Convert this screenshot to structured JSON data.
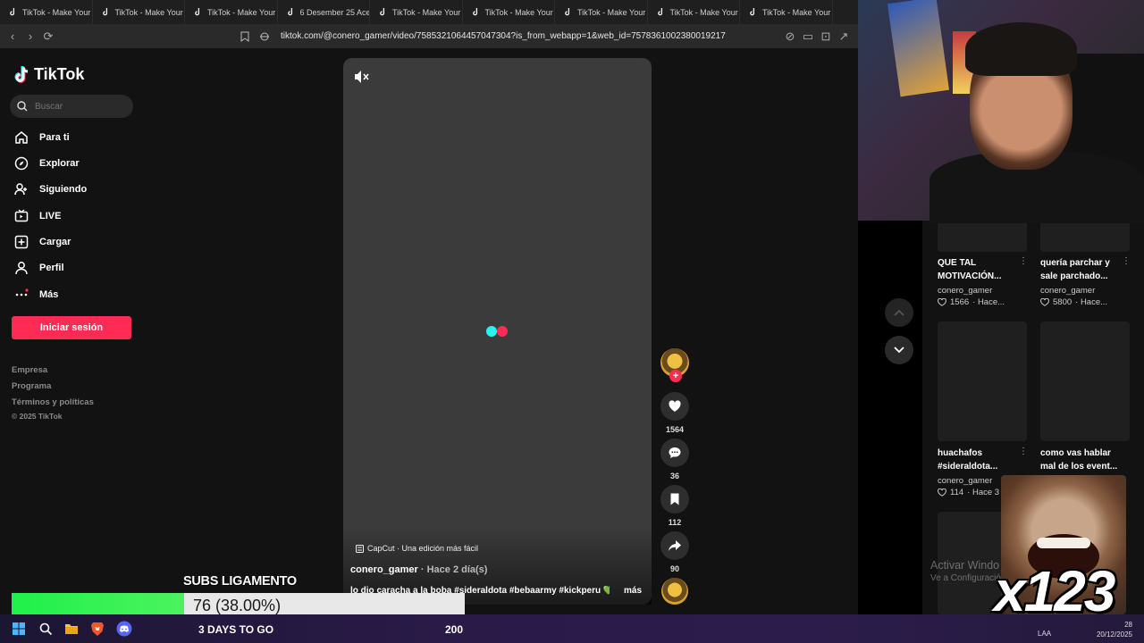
{
  "browser": {
    "tabs": [
      {
        "label": "TikTok - Make Your"
      },
      {
        "label": "TikTok - Make Your"
      },
      {
        "label": "TikTok - Make Your"
      },
      {
        "label": "6 Desember 25 Acer"
      },
      {
        "label": "TikTok - Make Your"
      },
      {
        "label": "TikTok - Make Your"
      },
      {
        "label": "TikTok - Make Your"
      },
      {
        "label": "TikTok - Make Your"
      },
      {
        "label": "TikTok - Make Your"
      }
    ],
    "url": "tiktok.com/@conero_gamer/video/7585321064457047304?is_from_webapp=1&web_id=7578361002380019217"
  },
  "tiktok": {
    "logo_text": "TikTok",
    "search_placeholder": "Buscar",
    "nav": [
      {
        "label": "Para ti",
        "icon": "home-icon"
      },
      {
        "label": "Explorar",
        "icon": "compass-icon"
      },
      {
        "label": "Siguiendo",
        "icon": "following-icon"
      },
      {
        "label": "LIVE",
        "icon": "live-icon"
      },
      {
        "label": "Cargar",
        "icon": "upload-icon"
      },
      {
        "label": "Perfil",
        "icon": "profile-icon"
      },
      {
        "label": "Más",
        "icon": "more-icon"
      }
    ],
    "login_label": "Iniciar sesión",
    "footer": [
      "Empresa",
      "Programa",
      "Términos y políticas",
      "© 2025 TikTok"
    ],
    "video": {
      "capcut": "CapCut · Una edición más fácil",
      "author": "conero_gamer",
      "ago": " · Hace 2 día(s)",
      "description": "lo dio caracha a la boba #sideraldota #bebaarmy #kickperu 💚 ...",
      "more": "más"
    },
    "actions": {
      "likes": "1564",
      "comments": "36",
      "saves": "112",
      "shares": "90"
    },
    "related": [
      {
        "title_1": "QUE TAL",
        "title_2": "MOTIVACIÓN...",
        "channel": "conero_gamer",
        "likes": "1566",
        "ago": "· Hace..."
      },
      {
        "title_1": "quería parchar y",
        "title_2": "sale parchado...",
        "channel": "conero_gamer",
        "likes": "5800",
        "ago": "· Hace..."
      },
      {
        "title_1": "huachafos",
        "title_2": "#sideraldota...",
        "channel": "conero_gamer",
        "likes": "114",
        "ago": "· Hace 3 c"
      },
      {
        "title_1": "como vas hablar",
        "title_2": "mal de los event...",
        "channel": "",
        "likes": "",
        "ago": ""
      }
    ]
  },
  "overlay": {
    "subs_title": "SUBS LIGAMENTO",
    "subs_progress": 0.38,
    "subs_text": "76 (38.00%)",
    "days_to_go": "3 DAYS TO GO",
    "goal": "200",
    "emote_multiplier": "x123",
    "colors": {
      "progress_fill": "#1ff04a",
      "tiktok_red": "#fe2c55"
    }
  },
  "system": {
    "activate_line1": "Activar Windo",
    "activate_line2": "Ve a Configuración",
    "lang": "LAA",
    "time": "28",
    "date": "20/12/2025"
  }
}
